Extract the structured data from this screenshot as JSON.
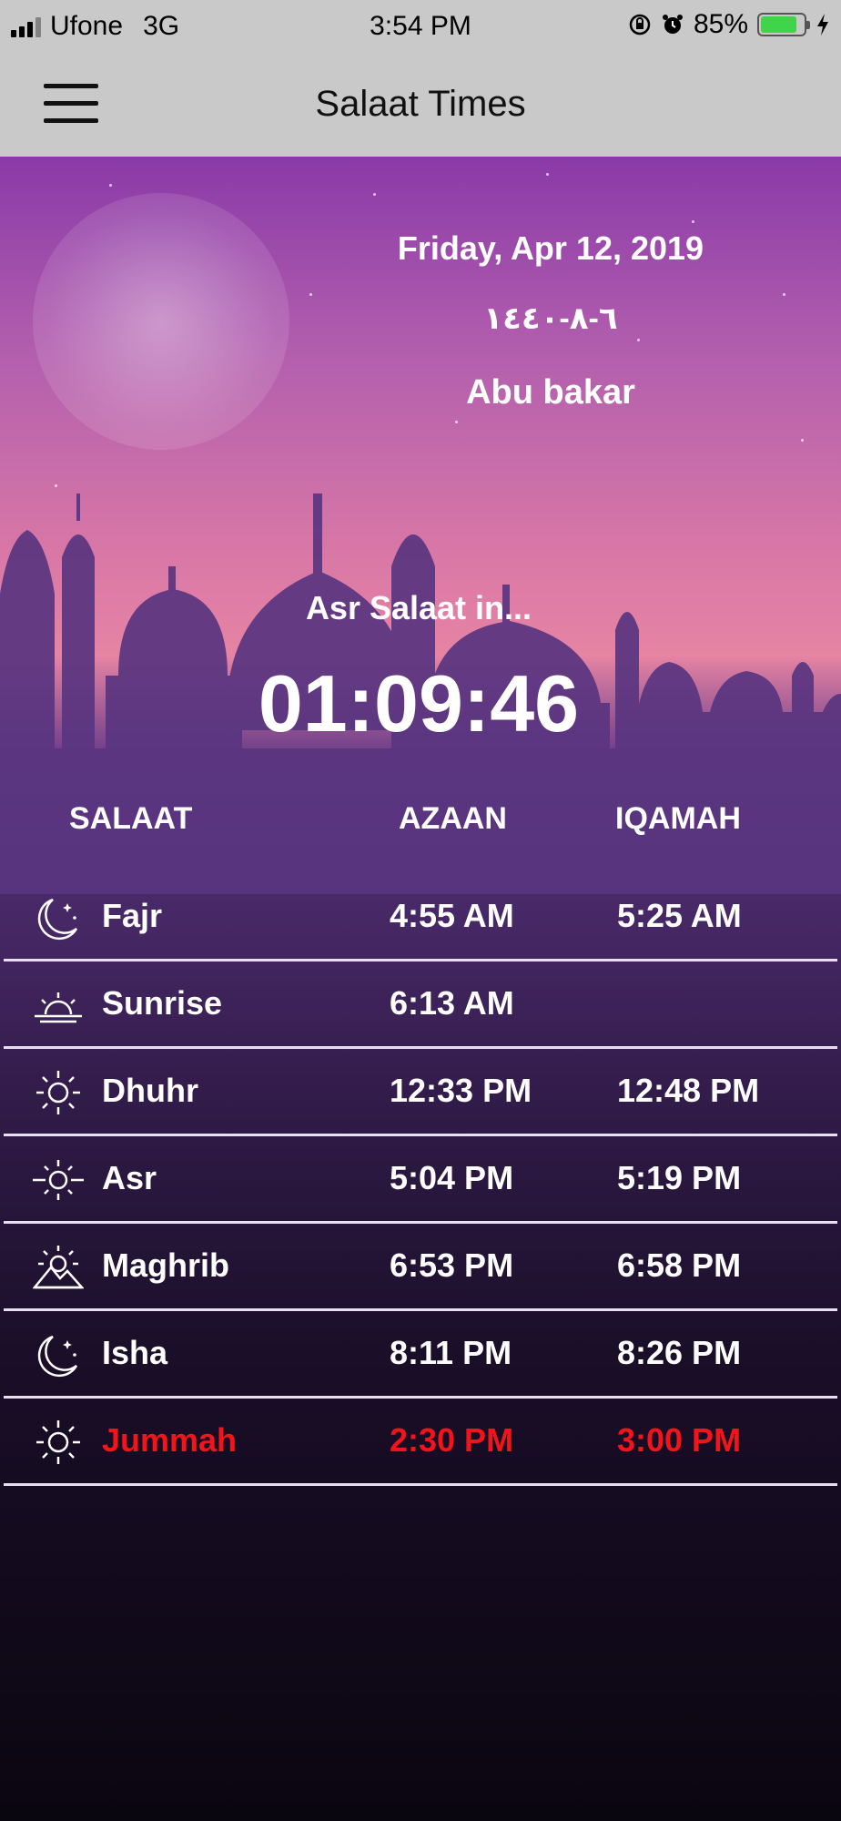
{
  "status_bar": {
    "carrier": "Ufone",
    "network": "3G",
    "time": "3:54 PM",
    "battery_percent": "85%",
    "battery_level": 0.85
  },
  "nav": {
    "title": "Salaat Times",
    "menu_icon": "hamburger-menu-icon"
  },
  "hero": {
    "date": "Friday, Apr 12, 2019",
    "hijri_date": "٦-٨-١٤٤٠",
    "user_name": "Abu bakar",
    "countdown_label": "Asr Salaat in...",
    "countdown_time": "01:09:46"
  },
  "table": {
    "headers": {
      "salaat": "SALAAT",
      "azaan": "AZAAN",
      "iqamah": "IQAMAH"
    },
    "rows": [
      {
        "name": "Fajr",
        "azaan": "4:55 AM",
        "iqamah": "5:25 AM",
        "icon": "crescent-stars-icon"
      },
      {
        "name": "Sunrise",
        "azaan": "6:13 AM",
        "iqamah": "",
        "icon": "sunrise-icon"
      },
      {
        "name": "Dhuhr",
        "azaan": "12:33 PM",
        "iqamah": "12:48 PM",
        "icon": "sun-icon"
      },
      {
        "name": "Asr",
        "azaan": "5:04 PM",
        "iqamah": "5:19 PM",
        "icon": "sun-horizon-icon"
      },
      {
        "name": "Maghrib",
        "azaan": "6:53 PM",
        "iqamah": "6:58 PM",
        "icon": "sunset-mountain-icon"
      },
      {
        "name": "Isha",
        "azaan": "8:11 PM",
        "iqamah": "8:26 PM",
        "icon": "crescent-stars-icon"
      },
      {
        "name": "Jummah",
        "azaan": "2:30 PM",
        "iqamah": "3:00 PM",
        "icon": "sun-icon",
        "highlight": true
      }
    ]
  },
  "colors": {
    "highlight": "#f2141b",
    "battery": "#3fd44a",
    "header_bg": "#c9c9c9"
  }
}
